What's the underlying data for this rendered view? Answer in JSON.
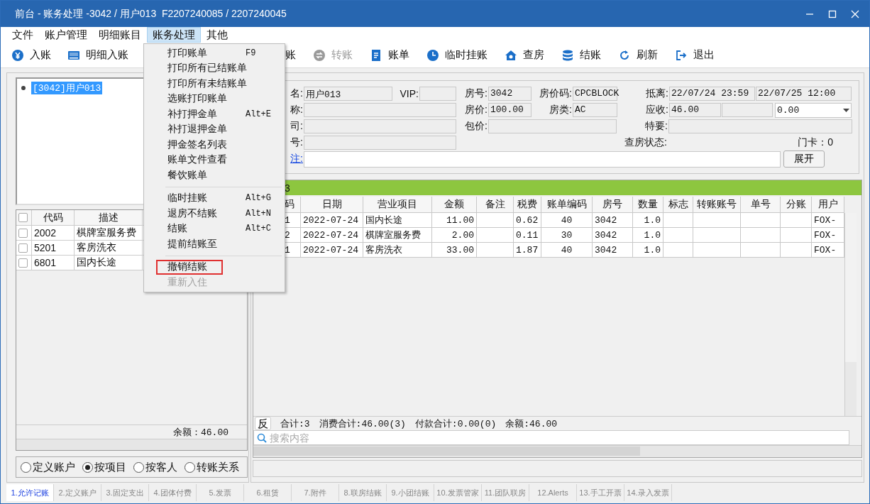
{
  "window": {
    "title": "前台 - 账务处理 -3042 / 用户013  F2207240085 / 2207240045"
  },
  "menu_bar": [
    {
      "label": "文件",
      "selected": false
    },
    {
      "label": "账户管理",
      "selected": false
    },
    {
      "label": "明细账目",
      "selected": false
    },
    {
      "label": "账务处理",
      "selected": true
    },
    {
      "label": "其他",
      "selected": false
    }
  ],
  "toolbar": [
    {
      "label": "入账",
      "disabled": false
    },
    {
      "label": "明细入账",
      "disabled": false
    },
    {
      "label": "账",
      "disabled": false
    },
    {
      "label": "转账",
      "disabled": true
    },
    {
      "label": "账单",
      "disabled": false
    },
    {
      "label": "临时挂账",
      "disabled": false
    },
    {
      "label": "查房",
      "disabled": false
    },
    {
      "label": "结账",
      "disabled": false
    },
    {
      "label": "刷新",
      "disabled": false
    },
    {
      "label": "退出",
      "disabled": false
    }
  ],
  "tree": [
    {
      "label": "[3042]用户013",
      "selected": true
    }
  ],
  "item_grid": {
    "all_checked": false,
    "columns": [
      "代码",
      "描述"
    ],
    "rows": [
      {
        "checked": false,
        "cells": [
          "2002",
          "棋牌室服务费"
        ]
      },
      {
        "checked": false,
        "cells": [
          "5201",
          "客房洗衣"
        ]
      },
      {
        "checked": false,
        "cells": [
          "6801",
          "国内长途"
        ]
      }
    ],
    "balance": "余额：46.00"
  },
  "view_options": [
    {
      "label": "定义账户",
      "selected": false
    },
    {
      "label": "按项目",
      "selected": true
    },
    {
      "label": "按客人",
      "selected": false
    },
    {
      "label": "转账关系",
      "selected": false
    }
  ],
  "guest_info": {
    "lines": [
      {
        "items": [
          {
            "kind": "label",
            "text": "名:"
          },
          {
            "kind": "field",
            "value": "用户013"
          },
          {
            "kind": "label",
            "text": "VIP:"
          },
          {
            "kind": "field"
          },
          {
            "kind": "label",
            "text": "房号:"
          },
          {
            "kind": "field",
            "value": "3042"
          },
          {
            "kind": "label",
            "text": "房价码:"
          },
          {
            "kind": "field",
            "value": "CPCBLOCK"
          },
          {
            "kind": "label",
            "text": "抵离:"
          },
          {
            "kind": "field",
            "value": "22/07/24 23:59"
          },
          {
            "kind": "field",
            "value": "22/07/25 12:00"
          }
        ]
      },
      {
        "items": [
          {
            "kind": "label",
            "text": "称:"
          },
          {
            "kind": "field"
          },
          {
            "kind": "label",
            "text": "房价:"
          },
          {
            "kind": "field",
            "value": "100.00"
          },
          {
            "kind": "label",
            "text": "房类:"
          },
          {
            "kind": "field",
            "value": "AC"
          },
          {
            "kind": "label",
            "text": "应收:"
          },
          {
            "kind": "field",
            "value": "46.00"
          },
          {
            "kind": "field"
          },
          {
            "kind": "select",
            "value": "0.00"
          }
        ]
      },
      {
        "items": [
          {
            "kind": "label",
            "text": "司:"
          },
          {
            "kind": "field"
          },
          {
            "kind": "label",
            "text": "包价:"
          },
          {
            "kind": "field"
          },
          {
            "kind": "label",
            "text": "特要:"
          },
          {
            "kind": "field"
          }
        ]
      },
      {
        "items": [
          {
            "kind": "label",
            "text": "号:"
          },
          {
            "kind": "field"
          },
          {
            "kind": "label",
            "text": "查房状态:"
          },
          {
            "kind": "label",
            "text": "门卡：0"
          }
        ]
      },
      {
        "items": [
          {
            "kind": "link",
            "text": "注:"
          },
          {
            "kind": "input"
          },
          {
            "kind": "button",
            "text": "展开"
          }
        ]
      }
    ]
  },
  "folio": {
    "header": "3",
    "columns": [
      "码",
      "日期",
      "营业项目",
      "金额",
      "备注",
      "税费",
      "账单编码",
      "房号",
      "数量",
      "标志",
      "转账账号",
      "单号",
      "分账",
      "用户"
    ],
    "rows": [
      [
        "1",
        "2022-07-24",
        "国内长途",
        "11.00",
        "",
        "0.62",
        "40",
        "3042",
        "1.0",
        "",
        "",
        "",
        "",
        "FOX-"
      ],
      [
        "2",
        "2022-07-24",
        "棋牌室服务费",
        "2.00",
        "",
        "0.11",
        "30",
        "3042",
        "1.0",
        "",
        "",
        "",
        "",
        "FOX-"
      ],
      [
        "1",
        "2022-07-24",
        "客房洗衣",
        "33.00",
        "",
        "1.87",
        "40",
        "3042",
        "1.0",
        "",
        "",
        "",
        "",
        "FOX-"
      ]
    ],
    "summary_button": "反",
    "summary": [
      "合计:3",
      "消费合计:46.00(3)",
      "付款合计:0.00(0)",
      "余额:46.00"
    ],
    "search": {
      "placeholder": "搜索内容"
    }
  },
  "dropdown": {
    "groups": [
      [
        {
          "label": "打印账单",
          "shortcut": "F9",
          "disabled": false,
          "highlighted": false
        },
        {
          "label": "打印所有已结账单",
          "disabled": false,
          "highlighted": false
        },
        {
          "label": "打印所有未结账单",
          "disabled": false,
          "highlighted": false
        },
        {
          "label": "选账打印账单",
          "disabled": false,
          "highlighted": false
        },
        {
          "label": "补打押金单",
          "shortcut": "Alt+E",
          "disabled": false,
          "highlighted": false
        },
        {
          "label": "补打退押金单",
          "disabled": false,
          "highlighted": false
        },
        {
          "label": "押金签名列表",
          "disabled": false,
          "highlighted": false
        },
        {
          "label": "账单文件查看",
          "disabled": false,
          "highlighted": false
        },
        {
          "label": "餐饮账单",
          "disabled": false,
          "highlighted": false
        }
      ],
      [
        {
          "label": "临时挂账",
          "shortcut": "Alt+G",
          "disabled": false,
          "highlighted": false
        },
        {
          "label": "退房不结账",
          "shortcut": "Alt+N",
          "disabled": false,
          "highlighted": false
        },
        {
          "label": "结账",
          "shortcut": "Alt+C",
          "disabled": false,
          "highlighted": false
        },
        {
          "label": "提前结账至",
          "disabled": false,
          "highlighted": false
        }
      ],
      [
        {
          "label": "撤销结账",
          "disabled": false,
          "highlighted": true
        },
        {
          "label": "重新入住",
          "disabled": true,
          "highlighted": false
        }
      ]
    ]
  },
  "tabs": [
    {
      "label": "1.允许记账",
      "selected": true
    },
    {
      "label": "2.定义账户",
      "selected": false
    },
    {
      "label": "3.固定支出",
      "selected": false
    },
    {
      "label": "4.团体付费",
      "selected": false
    },
    {
      "label": "5.发票",
      "selected": false
    },
    {
      "label": "6.租赁",
      "selected": false
    },
    {
      "label": "7.附件",
      "selected": false
    },
    {
      "label": "8.联房结账",
      "selected": false
    },
    {
      "label": "9.小团结账",
      "selected": false
    },
    {
      "label": "10.发票管家",
      "selected": false
    },
    {
      "label": "11.团队联房",
      "selected": false
    },
    {
      "label": "12.Alerts",
      "selected": false
    },
    {
      "label": "13.手工开票",
      "selected": false
    },
    {
      "label": "14.录入发票",
      "selected": false
    }
  ]
}
